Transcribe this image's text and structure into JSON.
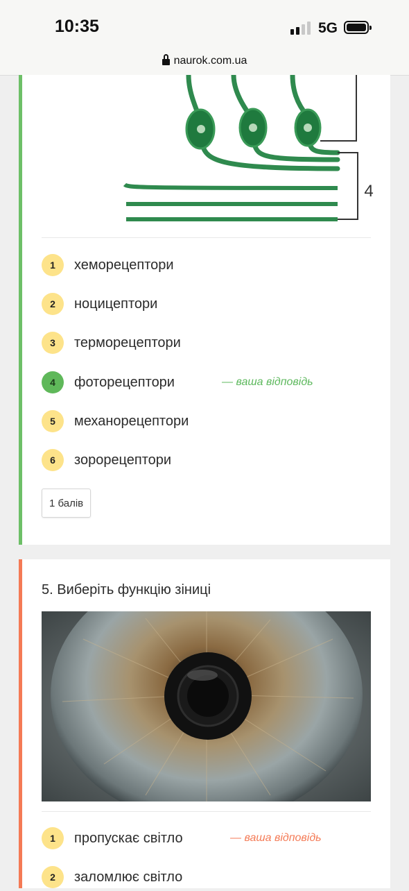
{
  "status_bar": {
    "time": "10:35",
    "network": "5G",
    "signal_bars_active": 2,
    "signal_bars_total": 4
  },
  "browser": {
    "url": "naurok.com.ua"
  },
  "question4": {
    "figure_label": "4",
    "options": [
      {
        "number": "1",
        "label": "хеморецептори",
        "selected": false
      },
      {
        "number": "2",
        "label": "ноцицептори",
        "selected": false
      },
      {
        "number": "3",
        "label": "терморецептори",
        "selected": false
      },
      {
        "number": "4",
        "label": "фоторецептори",
        "selected": true
      },
      {
        "number": "5",
        "label": "механорецептори",
        "selected": false
      },
      {
        "number": "6",
        "label": "зорорецептори",
        "selected": false
      }
    ],
    "your_answer_note": "— ваша відповідь",
    "score": "1 балів",
    "accent_color": "#6dbf67"
  },
  "question5": {
    "title": "5. Виберіть функцію зіниці",
    "options": [
      {
        "number": "1",
        "label": "пропускає світло",
        "selected": true
      },
      {
        "number": "2",
        "label": "заломлює світло",
        "selected": false
      }
    ],
    "your_answer_note": "— ваша відповідь",
    "accent_color": "#f47a55"
  }
}
